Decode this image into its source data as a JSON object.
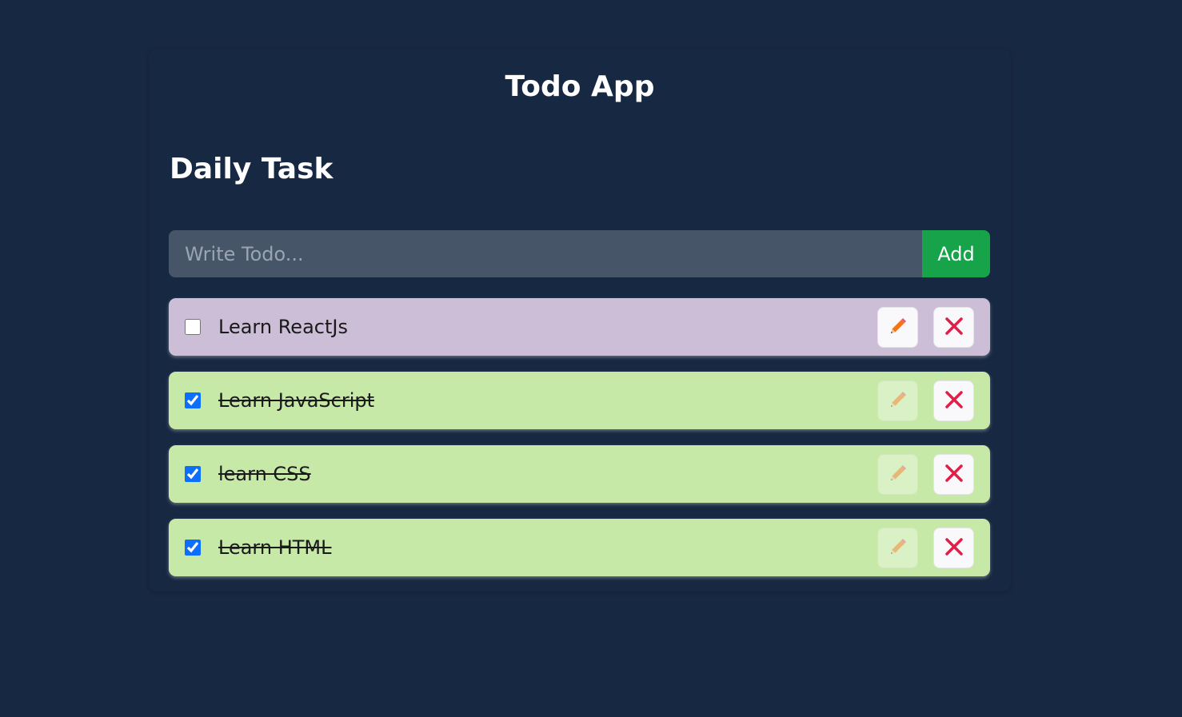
{
  "app": {
    "title": "Todo App"
  },
  "section": {
    "title": "Daily Task"
  },
  "form": {
    "input_value": "",
    "input_placeholder": "Write Todo...",
    "add_label": "Add"
  },
  "colors": {
    "background": "#172842",
    "open_item": "#ccbed7",
    "done_item": "#c6e9a7",
    "add_button": "#16a34a",
    "input_bg": "#475569",
    "delete_icon": "#e11d48",
    "edit_icon": "#f97316"
  },
  "icons": {
    "edit": "pencil-icon",
    "delete": "close-icon"
  },
  "todos": [
    {
      "text": "Learn ReactJs",
      "completed": false
    },
    {
      "text": "Learn JavaScript",
      "completed": true
    },
    {
      "text": "learn CSS",
      "completed": true
    },
    {
      "text": "Learn HTML",
      "completed": true
    }
  ]
}
